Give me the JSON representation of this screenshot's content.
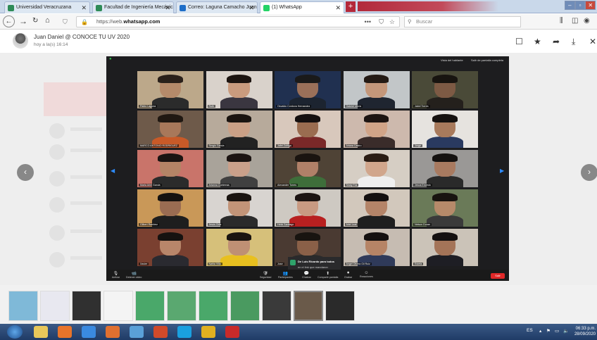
{
  "browser": {
    "tabs": [
      {
        "label": "Universidad Veracruzana",
        "favicon_color": "#2e8b57",
        "active": false
      },
      {
        "label": "Facultad de Ingeniería Mecánica",
        "favicon_color": "#2e8b57",
        "active": false
      },
      {
        "label": "Correo: Laguna Camacho Juan",
        "favicon_color": "#1e6ec8",
        "active": false
      },
      {
        "label": "(1) WhatsApp",
        "favicon_color": "#25d366",
        "active": true
      }
    ],
    "new_tab": "+",
    "url_prefix": "https://web.",
    "url_domain": "whatsapp.com",
    "search_placeholder": "Buscar",
    "url_actions": {
      "more": "•••",
      "pocket": "⛉",
      "star": "☆"
    }
  },
  "viewer": {
    "sender": "Juan Daniel @ CONOCE TU UV 2020",
    "timestamp": "hoy a la(s) 16:14",
    "actions": {
      "comment": "☐",
      "star": "★",
      "forward": "➦",
      "download": "⤓",
      "close": "✕"
    },
    "prev": "‹",
    "next": "›"
  },
  "zoom": {
    "top_buttons": [
      "Vista del hablante",
      "Salir de pantalla completa"
    ],
    "participants": [
      {
        "name": "Pablo Laguna",
        "bg": "#bca88a",
        "skin": "#b58a6a",
        "hair": "#2a201a",
        "shirt": "#2b2b2b"
      },
      {
        "name": "Ruth",
        "bg": "#d9d2cb",
        "skin": "#c99b7e",
        "hair": "#1c1410",
        "shirt": "#3a3640"
      },
      {
        "name": "Osvaldo Cordova Hernandez",
        "bg": "#203050",
        "skin": "#9a7059",
        "hair": "#1a1a1a",
        "shirt": "#1c2430"
      },
      {
        "name": "Gabriel Meza",
        "bg": "#c2c6c8",
        "skin": "#c4977a",
        "hair": "#241a14",
        "shirt": "#1f2530"
      },
      {
        "name": "Jabel Torres",
        "bg": "#4a4a38",
        "skin": "#7d5a44",
        "hair": "#181410",
        "shirt": "#24201c"
      },
      {
        "name": "MARCO ANTONIO RODRIGUEZ",
        "bg": "#6e5a4a",
        "skin": "#a8785a",
        "hair": "#201812",
        "shirt": "#c85a28"
      },
      {
        "name": "Sergio Garcia",
        "bg": "#b7aa9b",
        "skin": "#caa086",
        "hair": "#1a1410",
        "shirt": "#222222"
      },
      {
        "name": "Jafet Zúñiga",
        "bg": "#d8c8bc",
        "skin": "#9a6c50",
        "hair": "#151010",
        "shirt": "#7a2828"
      },
      {
        "name": "Ariana Castro",
        "bg": "#cdb9ad",
        "skin": "#d0a488",
        "hair": "#1c1412",
        "shirt": "#3a2c2a"
      },
      {
        "name": "Jorge",
        "bg": "#e6e3df",
        "skin": "#a87a5c",
        "hair": "#161210",
        "shirt": "#2a3a60"
      },
      {
        "name": "Marla Ariel Garcia",
        "bg": "#c9746a",
        "skin": "#b48466",
        "hair": "#1a1412",
        "shirt": "#2b2b2b"
      },
      {
        "name": "Arianna Contreras",
        "bg": "#a9a39a",
        "skin": "#caa08a",
        "hair": "#1c1412",
        "shirt": "#404040"
      },
      {
        "name": "Alexander Torres",
        "bg": "#4f4336",
        "skin": "#b08068",
        "hair": "#1a1410",
        "shirt": "#3e6e3a"
      },
      {
        "name": "Sealy Fdz",
        "bg": "#d6cec4",
        "skin": "#d1a68c",
        "hair": "#2a1c14",
        "shirt": "#efefef"
      },
      {
        "name": "Jesus Ernesto",
        "bg": "#9a9896",
        "skin": "#a87a60",
        "hair": "#151210",
        "shirt": "#2a2a2a"
      },
      {
        "name": "Gilbert Ramirez",
        "bg": "#c99858",
        "skin": "#9a6c52",
        "hair": "#161210",
        "shirt": "#1e1e1e"
      },
      {
        "name": "Jesús Ortiz",
        "bg": "#d8d4d0",
        "skin": "#c29478",
        "hair": "#1a1410",
        "shirt": "#2a2a2a"
      },
      {
        "name": "Hefzi Santiago",
        "bg": "#cec9c2",
        "skin": "#c89a82",
        "hair": "#1c1412",
        "shirt": "#b82020"
      },
      {
        "name": "Ariel Leal",
        "bg": "#d2c8bc",
        "skin": "#b48468",
        "hair": "#141010",
        "shirt": "#1e1e1e"
      },
      {
        "name": "Nelson Duran",
        "bg": "#6a7a58",
        "skin": "#b68a6a",
        "hair": "#181410",
        "shirt": "#3a3a3a"
      },
      {
        "name": "Xavier",
        "bg": "#7a4030",
        "skin": "#b8866a",
        "hair": "#161210",
        "shirt": "#2a2a30"
      },
      {
        "name": "Nahia Villa",
        "bg": "#d6c07a",
        "skin": "#bf9074",
        "hair": "#1a1410",
        "shirt": "#e8c020"
      },
      {
        "name": "Jose",
        "bg": "#4a3a32",
        "skin": "#8a6048",
        "hair": "#181410",
        "shirt": "#2a2a2a"
      },
      {
        "name": "Angel Olvera Gil Ruiz",
        "bg": "#c6bcb2",
        "skin": "#b68466",
        "hair": "#141010",
        "shirt": "#2f3a5a"
      },
      {
        "name": "Estefa",
        "bg": "#cbc3b8",
        "skin": "#a47458",
        "hair": "#141010",
        "shirt": "#1e1e24"
      }
    ],
    "chat_popup": {
      "title": "De Luis Ricardo para todos",
      "message": "en el link que mandaron"
    },
    "controls": [
      {
        "label": "Activar",
        "glyph": "🎙"
      },
      {
        "label": "Detener video",
        "glyph": "📹"
      },
      {
        "label": "Seguridad",
        "glyph": "🛡"
      },
      {
        "label": "Participantes",
        "glyph": "👥"
      },
      {
        "label": "Chatear",
        "glyph": "💬"
      },
      {
        "label": "Compartir pantalla",
        "glyph": "⬆"
      },
      {
        "label": "Grabar",
        "glyph": "⏺"
      },
      {
        "label": "Reacciones",
        "glyph": "☺"
      }
    ],
    "end_label": "Salir"
  },
  "thumbnails": [
    {
      "color": "#7fb9d8"
    },
    {
      "color": "#e8e8f0"
    },
    {
      "color": "#303030"
    },
    {
      "color": "#f4f4f4"
    },
    {
      "color": "#4aa86a"
    },
    {
      "color": "#5aa870"
    },
    {
      "color": "#4aa86a"
    },
    {
      "color": "#4a9a60"
    },
    {
      "color": "#3a3a3a"
    },
    {
      "color": "#6a5a4a"
    },
    {
      "color": "#2a2a2a"
    }
  ],
  "taskbar": {
    "apps": [
      {
        "name": "explorer-icon",
        "color": "#e8c85a"
      },
      {
        "name": "firefox-icon",
        "color": "#e8742a"
      },
      {
        "name": "ie-icon",
        "color": "#3a8ae0"
      },
      {
        "name": "media-icon",
        "color": "#e07030"
      },
      {
        "name": "photos-icon",
        "color": "#5aa0d8"
      },
      {
        "name": "powerpoint-icon",
        "color": "#d04a2a"
      },
      {
        "name": "skype-icon",
        "color": "#1aa0e0"
      },
      {
        "name": "chrome-icon",
        "color": "#e0b020"
      },
      {
        "name": "acrobat-icon",
        "color": "#c82a2a"
      }
    ],
    "lang": "ES",
    "time": "06:33 p.m.",
    "date": "28/09/2020"
  }
}
